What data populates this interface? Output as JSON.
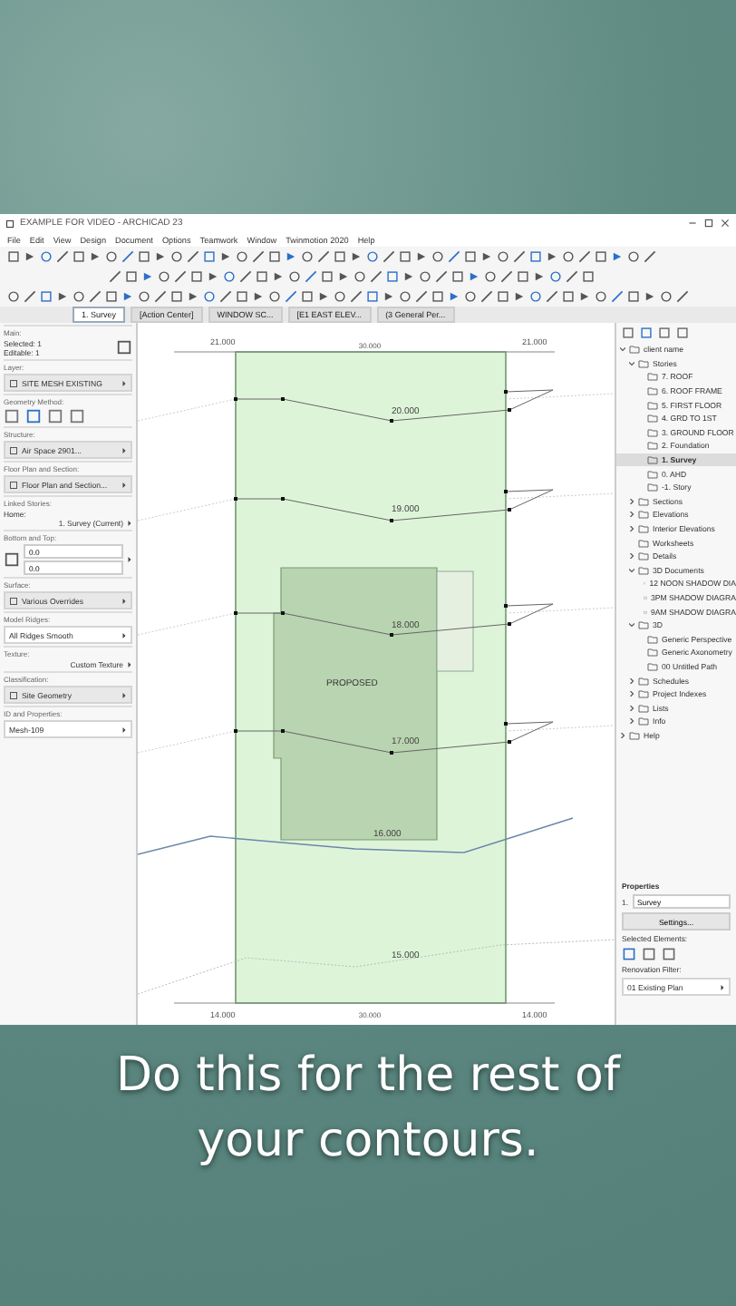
{
  "window": {
    "title": "EXAMPLE FOR VIDEO - ARCHICAD 23"
  },
  "menu": [
    "File",
    "Edit",
    "View",
    "Design",
    "Document",
    "Options",
    "Teamwork",
    "Window",
    "Twinmotion 2020",
    "Help"
  ],
  "tabs": [
    {
      "label": "1. Survey",
      "selected": true
    },
    {
      "label": "[Action Center]",
      "selected": false
    },
    {
      "label": "WINDOW SC...",
      "selected": false
    },
    {
      "label": "[E1 EAST ELEV...",
      "selected": false
    },
    {
      "label": "(3 General Per...",
      "selected": false
    }
  ],
  "info_box": [
    {
      "title": "Main:",
      "lines": [
        "Selected: 1",
        "Editable: 1"
      ],
      "kind": "icon"
    },
    {
      "title": "Layer:",
      "value": "SITE MESH EXISTING",
      "kind": "select"
    },
    {
      "title": "Geometry Method:",
      "kind": "methods"
    },
    {
      "title": "Structure:",
      "value": "Air Space 2901...",
      "kind": "select"
    },
    {
      "title": "Floor Plan and Section:",
      "value": "Floor Plan and Section...",
      "kind": "select"
    },
    {
      "title": "Linked Stories:",
      "label": "Home:",
      "value": "1. Survey (Current)",
      "kind": "text"
    },
    {
      "title": "Bottom and Top:",
      "values": [
        "0.0",
        "0.0"
      ],
      "kind": "inputs"
    },
    {
      "title": "Surface:",
      "value": "Various Overrides",
      "kind": "select"
    },
    {
      "title": "Model Ridges:",
      "value": "All Ridges Smooth",
      "kind": "dropdown"
    },
    {
      "title": "Texture:",
      "value": "Custom Texture",
      "kind": "text"
    },
    {
      "title": "Classification:",
      "value": "Site Geometry",
      "kind": "select"
    },
    {
      "title": "ID and Properties:",
      "value": "Mesh-109",
      "kind": "dropdown"
    }
  ],
  "canvas": {
    "top_dimension": "30.000",
    "corner_labels": [
      "21.000",
      "21.000",
      "14.000",
      "14.000"
    ],
    "bottom_dimension": "30.000",
    "contours": [
      "20.000",
      "19.000",
      "18.000",
      "17.000",
      "16.000",
      "15.000"
    ],
    "building_label": "PROPOSED"
  },
  "navigator": {
    "tree": [
      {
        "label": "client name",
        "expanded": true,
        "children": [
          {
            "label": "Stories",
            "expanded": true,
            "children": [
              {
                "label": "7. ROOF",
                "selected": false
              },
              {
                "label": "6. ROOF FRAME",
                "selected": false
              },
              {
                "label": "5. FIRST FLOOR",
                "selected": false
              },
              {
                "label": "4. GRD TO 1ST",
                "selected": false
              },
              {
                "label": "3. GROUND FLOOR",
                "selected": false
              },
              {
                "label": "2. Foundation",
                "selected": false
              },
              {
                "label": "1. Survey",
                "selected": true
              },
              {
                "label": "0. AHD",
                "selected": false
              },
              {
                "label": "-1. Story",
                "selected": false
              }
            ]
          },
          {
            "label": "Sections",
            "expanded": false
          },
          {
            "label": "Elevations",
            "expanded": false
          },
          {
            "label": "Interior Elevations",
            "expanded": false
          },
          {
            "label": "Worksheets"
          },
          {
            "label": "Details",
            "expanded": false
          },
          {
            "label": "3D Documents",
            "expanded": true,
            "children": [
              {
                "label": "12 NOON SHADOW DIA"
              },
              {
                "label": "3PM SHADOW DIAGRA"
              },
              {
                "label": "9AM SHADOW DIAGRA"
              }
            ]
          },
          {
            "label": "3D",
            "expanded": true,
            "children": [
              {
                "label": "Generic Perspective"
              },
              {
                "label": "Generic Axonometry"
              },
              {
                "label": "00 Untitled Path"
              }
            ]
          },
          {
            "label": "Schedules",
            "expanded": false
          },
          {
            "label": "Project Indexes",
            "expanded": false
          },
          {
            "label": "Lists",
            "expanded": false
          },
          {
            "label": "Info",
            "expanded": false
          }
        ]
      },
      {
        "label": "Help",
        "expanded": false
      }
    ]
  },
  "properties": {
    "title": "Properties",
    "number": "1.",
    "name": "Survey",
    "button": "Settings...",
    "selected_elements": "Selected Elements:",
    "renovation_label": "Renovation Filter:",
    "renovation_value": "01 Existing Plan"
  },
  "caption": "Do this for the rest of your contours."
}
